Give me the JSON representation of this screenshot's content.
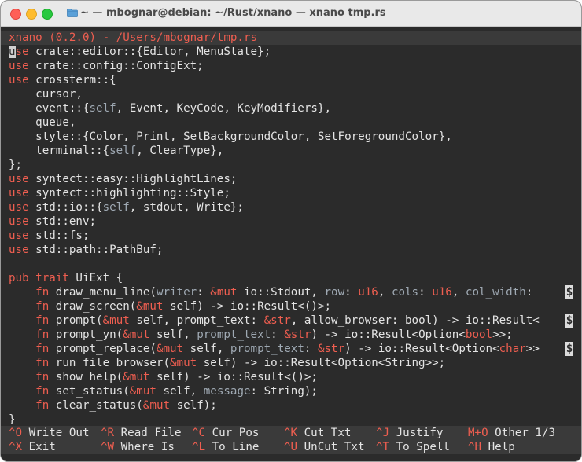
{
  "window": {
    "title": "~ — mbognar@debian: ~/Rust/xnano — xnano tmp.rs"
  },
  "editor": {
    "header": "xnano (0.2.0) - /Users/mbognar/tmp.rs",
    "cursor_char": "u",
    "lines": [
      [
        {
          "t": "se",
          "c": "kw"
        },
        {
          "t": " crate::editor::{Editor, MenuState};",
          "c": "p"
        }
      ],
      [
        {
          "t": "use",
          "c": "kw"
        },
        {
          "t": " crate::config::ConfigExt;",
          "c": "p"
        }
      ],
      [
        {
          "t": "use",
          "c": "kw"
        },
        {
          "t": " crossterm::{",
          "c": "p"
        }
      ],
      [
        {
          "t": "    cursor,",
          "c": "p"
        }
      ],
      [
        {
          "t": "    event::{",
          "c": "p"
        },
        {
          "t": "self",
          "c": "dim"
        },
        {
          "t": ", Event, KeyCode, KeyModifiers},",
          "c": "p"
        }
      ],
      [
        {
          "t": "    queue,",
          "c": "p"
        }
      ],
      [
        {
          "t": "    style::{Color, Print, SetBackgroundColor, SetForegroundColor},",
          "c": "p"
        }
      ],
      [
        {
          "t": "    terminal::{",
          "c": "p"
        },
        {
          "t": "self",
          "c": "dim"
        },
        {
          "t": ", ClearType},",
          "c": "p"
        }
      ],
      [
        {
          "t": "};",
          "c": "p"
        }
      ],
      [
        {
          "t": "use",
          "c": "kw"
        },
        {
          "t": " syntect::easy::HighlightLines;",
          "c": "p"
        }
      ],
      [
        {
          "t": "use",
          "c": "kw"
        },
        {
          "t": " syntect::highlighting::Style;",
          "c": "p"
        }
      ],
      [
        {
          "t": "use",
          "c": "kw"
        },
        {
          "t": " std::io::{",
          "c": "p"
        },
        {
          "t": "self",
          "c": "dim"
        },
        {
          "t": ", stdout, Write};",
          "c": "p"
        }
      ],
      [
        {
          "t": "use",
          "c": "kw"
        },
        {
          "t": " std::env;",
          "c": "p"
        }
      ],
      [
        {
          "t": "use",
          "c": "kw"
        },
        {
          "t": " std::fs;",
          "c": "p"
        }
      ],
      [
        {
          "t": "use",
          "c": "kw"
        },
        {
          "t": " std::path::PathBuf;",
          "c": "p"
        }
      ],
      [
        {
          "t": "",
          "c": "p"
        }
      ],
      [
        {
          "t": "pub trait",
          "c": "kw"
        },
        {
          "t": " UiExt {",
          "c": "p"
        }
      ],
      [
        {
          "t": "    ",
          "c": "p"
        },
        {
          "t": "fn",
          "c": "kw"
        },
        {
          "t": " draw_menu_line(",
          "c": "p"
        },
        {
          "t": "writer",
          "c": "dim"
        },
        {
          "t": ": ",
          "c": "p"
        },
        {
          "t": "&mut",
          "c": "kw"
        },
        {
          "t": " io::Stdout, ",
          "c": "p"
        },
        {
          "t": "row",
          "c": "dim"
        },
        {
          "t": ": ",
          "c": "p"
        },
        {
          "t": "u16",
          "c": "kw"
        },
        {
          "t": ", ",
          "c": "p"
        },
        {
          "t": "cols",
          "c": "dim"
        },
        {
          "t": ": ",
          "c": "p"
        },
        {
          "t": "u16",
          "c": "kw"
        },
        {
          "t": ", ",
          "c": "p"
        },
        {
          "t": "col_width",
          "c": "dim"
        },
        {
          "t": ":",
          "c": "p"
        }
      ],
      [
        {
          "t": "    ",
          "c": "p"
        },
        {
          "t": "fn",
          "c": "kw"
        },
        {
          "t": " draw_screen(",
          "c": "p"
        },
        {
          "t": "&mut",
          "c": "kw"
        },
        {
          "t": " self) -> io::Result<()>;",
          "c": "p"
        }
      ],
      [
        {
          "t": "    ",
          "c": "p"
        },
        {
          "t": "fn",
          "c": "kw"
        },
        {
          "t": " prompt(",
          "c": "p"
        },
        {
          "t": "&mut",
          "c": "kw"
        },
        {
          "t": " self, prompt_text: ",
          "c": "p"
        },
        {
          "t": "&str",
          "c": "kw"
        },
        {
          "t": ", allow_browser: bool) -> io::Result<",
          "c": "p"
        }
      ],
      [
        {
          "t": "    ",
          "c": "p"
        },
        {
          "t": "fn",
          "c": "kw"
        },
        {
          "t": " prompt_yn(",
          "c": "p"
        },
        {
          "t": "&mut",
          "c": "kw"
        },
        {
          "t": " self, ",
          "c": "p"
        },
        {
          "t": "prompt_text",
          "c": "dim"
        },
        {
          "t": ": ",
          "c": "p"
        },
        {
          "t": "&str",
          "c": "kw"
        },
        {
          "t": ") -> io::Result<Option<",
          "c": "p"
        },
        {
          "t": "bool",
          "c": "kw"
        },
        {
          "t": ">>;",
          "c": "p"
        }
      ],
      [
        {
          "t": "    ",
          "c": "p"
        },
        {
          "t": "fn",
          "c": "kw"
        },
        {
          "t": " prompt_replace(",
          "c": "p"
        },
        {
          "t": "&mut",
          "c": "kw"
        },
        {
          "t": " self, ",
          "c": "p"
        },
        {
          "t": "prompt_text",
          "c": "dim"
        },
        {
          "t": ": ",
          "c": "p"
        },
        {
          "t": "&str",
          "c": "kw"
        },
        {
          "t": ") -> io::Result<Option<",
          "c": "p"
        },
        {
          "t": "char",
          "c": "kw"
        },
        {
          "t": ">>",
          "c": "p"
        }
      ],
      [
        {
          "t": "    ",
          "c": "p"
        },
        {
          "t": "fn",
          "c": "kw"
        },
        {
          "t": " run_file_browser(",
          "c": "p"
        },
        {
          "t": "&mut",
          "c": "kw"
        },
        {
          "t": " self) -> io::Result<Option<String>>;",
          "c": "p"
        }
      ],
      [
        {
          "t": "    ",
          "c": "p"
        },
        {
          "t": "fn",
          "c": "kw"
        },
        {
          "t": " show_help(",
          "c": "p"
        },
        {
          "t": "&mut",
          "c": "kw"
        },
        {
          "t": " self) -> io::Result<()>;",
          "c": "p"
        }
      ],
      [
        {
          "t": "    ",
          "c": "p"
        },
        {
          "t": "fn",
          "c": "kw"
        },
        {
          "t": " set_status(",
          "c": "p"
        },
        {
          "t": "&mut",
          "c": "kw"
        },
        {
          "t": " self, ",
          "c": "p"
        },
        {
          "t": "message",
          "c": "dim"
        },
        {
          "t": ": String);",
          "c": "p"
        }
      ],
      [
        {
          "t": "    ",
          "c": "p"
        },
        {
          "t": "fn",
          "c": "kw"
        },
        {
          "t": " clear_status(",
          "c": "p"
        },
        {
          "t": "&mut",
          "c": "kw"
        },
        {
          "t": " self);",
          "c": "p"
        }
      ],
      [
        {
          "t": "}",
          "c": "p"
        }
      ]
    ],
    "overflow_marker": "$",
    "overflow_lines": [
      17,
      19,
      21
    ]
  },
  "shortcuts": [
    [
      {
        "key": "^O",
        "label": "Write Out"
      },
      {
        "key": "^R",
        "label": "Read File"
      },
      {
        "key": "^C",
        "label": "Cur Pos"
      },
      {
        "key": "^K",
        "label": "Cut Txt"
      },
      {
        "key": "^J",
        "label": "Justify"
      },
      {
        "key": "M+O",
        "label": "Other 1/3"
      }
    ],
    [
      {
        "key": "^X",
        "label": "Exit"
      },
      {
        "key": "^W",
        "label": "Where Is"
      },
      {
        "key": "^L",
        "label": "To Line"
      },
      {
        "key": "^U",
        "label": "UnCut Txt"
      },
      {
        "key": "^T",
        "label": "To Spell"
      },
      {
        "key": "^H",
        "label": "Help"
      }
    ]
  ],
  "colors": {
    "keyword": "#ee5e50",
    "plain": "#e4e4e4",
    "param": "#9fa9b3",
    "background": "#2b2b2b"
  }
}
